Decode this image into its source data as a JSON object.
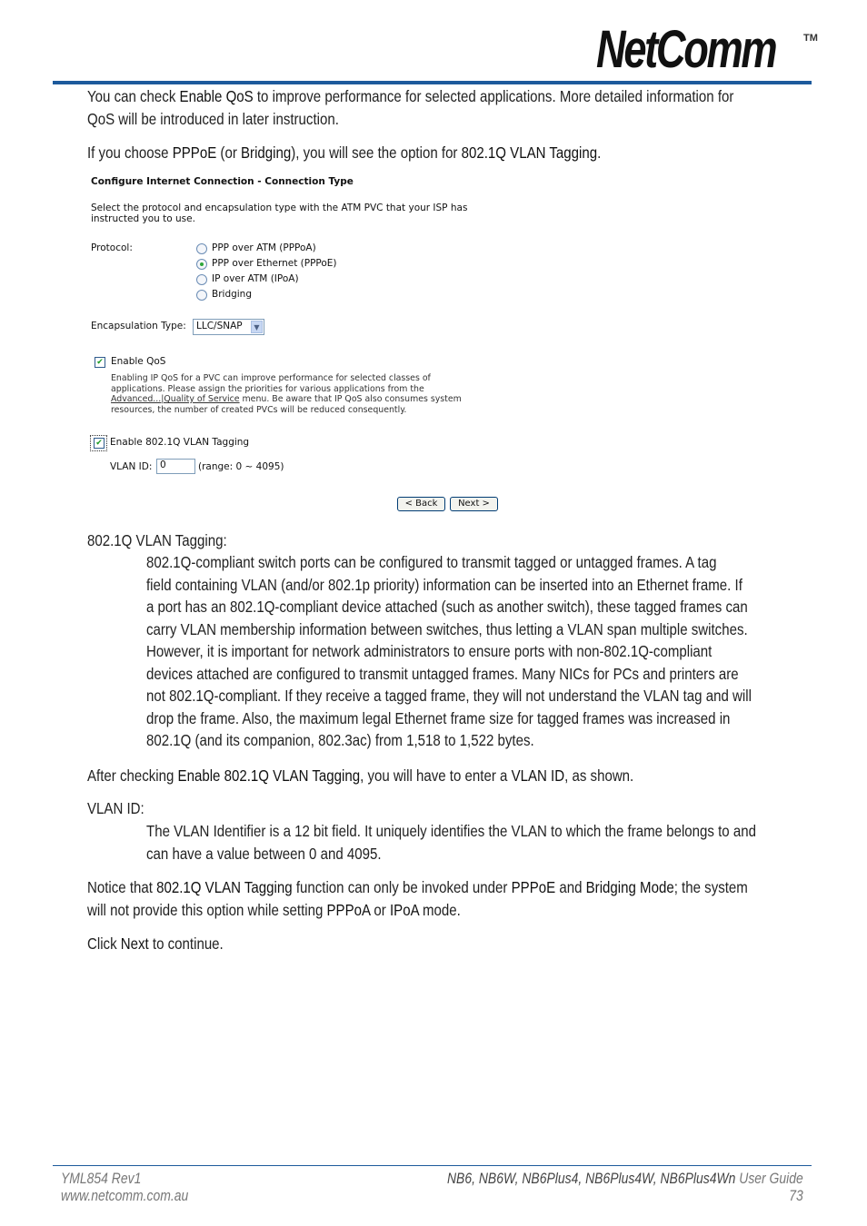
{
  "header": {
    "logo_text": "NetComm",
    "trademark": "TM"
  },
  "intro": {
    "qos_sentence": {
      "pre": "You can check ",
      "bold1": "Enable QoS",
      "post1": " to improve performance for selected applications. More detailed information for",
      "line2": "QoS will be introduced in later instruction."
    },
    "pppoe_sentence": {
      "pre": "If you choose ",
      "bold1": "PPPoE",
      "mid1": " (or ",
      "bold2": "Bridging",
      "mid2": "), you will see the option for ",
      "bold3": "802.1Q VLAN Tagging",
      "post": "."
    }
  },
  "ui": {
    "title": "Configure Internet Connection - Connection Type",
    "instruction_line1": "Select the protocol and encapsulation type with the ATM PVC that your ISP has",
    "instruction_line2": "instructed you to use.",
    "protocol_label": "Protocol:",
    "protocols": [
      {
        "label": "PPP over ATM (PPPoA)",
        "selected": false
      },
      {
        "label": "PPP over Ethernet (PPPoE)",
        "selected": true
      },
      {
        "label": "IP over ATM (IPoA)",
        "selected": false
      },
      {
        "label": "Bridging",
        "selected": false
      }
    ],
    "encapsulation_label": "Encapsulation Type:",
    "encapsulation_value": "LLC/SNAP",
    "enable_qos_label": "Enable QoS",
    "enable_qos_checked": true,
    "qos_desc_line1": "Enabling IP QoS for a PVC can improve performance for selected classes of",
    "qos_desc_line2": "applications. Please assign the priorities for various applications from the",
    "qos_desc_link": "Advanced...|Quality of Service",
    "qos_desc_line3_rest": " menu. Be aware that IP QoS also consumes system",
    "qos_desc_line4": "resources, the number of created PVCs will be reduced consequently.",
    "vlan_tagging_label": "Enable 802.1Q VLAN Tagging",
    "vlan_tagging_checked": true,
    "vlan_id_label": "VLAN ID:",
    "vlan_id_value": "0",
    "vlan_range": "(range: 0 ~ 4095)",
    "back_button": "< Back",
    "next_button": "Next >"
  },
  "sections": {
    "vlan_tagging_heading": "802.1Q VLAN Tagging:",
    "vlan_tagging_lines": [
      "802.1Q-compliant switch ports can be configured to transmit tagged or untagged frames. A tag",
      "field containing VLAN (and/or 802.1p priority) information can be inserted into an Ethernet frame. If",
      "a port has an 802.1Q-compliant device attached (such as another switch), these tagged frames can",
      "carry VLAN membership information between switches, thus letting a VLAN span multiple switches.",
      "However, it is important for network administrators to ensure ports with non-802.1Q-compliant",
      "devices attached are configured to transmit untagged frames. Many NICs for PCs and printers are",
      "not 802.1Q-compliant. If they receive a tagged frame, they will not understand the VLAN tag and will",
      "drop the frame. Also, the maximum legal Ethernet frame size for tagged frames was increased in",
      "802.1Q (and its companion, 802.3ac) from 1,518 to 1,522 bytes."
    ],
    "after_checking": {
      "pre": "After checking ",
      "bold1": "Enable 802.1Q VLAN Tagging",
      "mid": ", you will have to enter a ",
      "bold2": "VLAN ID",
      "post": ", as shown."
    },
    "vlan_id_heading": "VLAN ID:",
    "vlan_id_lines": [
      "The VLAN Identifier is a 12 bit field. It uniquely identifies the VLAN to which the frame belongs to and",
      "can have a value between 0 and 4095."
    ],
    "notice": {
      "pre": "Notice that ",
      "bold1": "802.1Q VLAN Tagging",
      "mid1": " function can only be invoked under ",
      "bold2": "PPPoE",
      "mid2": " and ",
      "bold3": "Bridging Mode",
      "mid3": "; the system",
      "line2_pre": "will not provide this option while setting ",
      "bold4": "PPPoA",
      "mid4": " or ",
      "bold5": "IPoA",
      "post": " mode."
    },
    "click_next": {
      "pre": "Click ",
      "bold": "Next",
      "post": " to continue."
    }
  },
  "footer": {
    "doc_id": "YML854 Rev1",
    "website": "www.netcomm.com.au",
    "models": "NB6, NB6W, NB6Plus4, NB6Plus4W, NB6Plus4Wn",
    "guide": " User Guide",
    "page_number": "73"
  }
}
